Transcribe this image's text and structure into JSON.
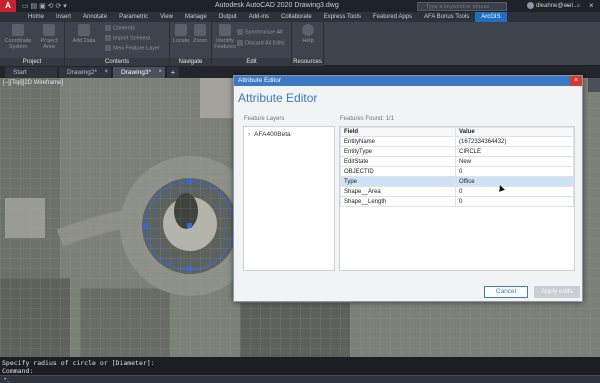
{
  "app": {
    "logo": "A",
    "title": "Autodesk AutoCAD 2020    Drawing3.dwg",
    "search_placeholder": "Type a keyword or phrase",
    "user": "dleahne@esri...",
    "window_controls": [
      "–",
      "▫",
      "×"
    ]
  },
  "ribbon_tabs": [
    "Home",
    "Insert",
    "Annotate",
    "Parametric",
    "View",
    "Manage",
    "Output",
    "Add-ins",
    "Collaborate",
    "Express Tools",
    "Featured Apps",
    "AFA Bonus Tools",
    "ArcGIS"
  ],
  "ribbon_active_tab": "ArcGIS",
  "ribbon_panels": {
    "project": {
      "label": "Project",
      "buttons": [
        "Coordinate System",
        "Project Area"
      ]
    },
    "contents": {
      "label": "Contents",
      "big": "Add Data",
      "small": [
        "Contents",
        "Import Schema",
        "New Feature Layer"
      ]
    },
    "navigate": {
      "label": "Navigate",
      "buttons": [
        "Locate",
        "Zoom"
      ]
    },
    "edit": {
      "label": "Edit",
      "big": "Identify Features",
      "small": [
        "Synchronize All",
        "Discard All Edits"
      ]
    },
    "resources": {
      "label": "Resources",
      "big": "Help"
    }
  },
  "doc_tabs": [
    {
      "label": "Start",
      "closable": false
    },
    {
      "label": "Drawing2*",
      "closable": true
    },
    {
      "label": "Drawing3*",
      "closable": true
    }
  ],
  "viewport": {
    "label": "[–][Top][2D Wireframe]"
  },
  "command_line": {
    "history": "Specify radius of circle or [Diameter]:",
    "prompt": "Command:"
  },
  "dialog": {
    "title": "Attribute Editor",
    "heading": "Attribute Editor",
    "feature_layers_label": "Feature Layers",
    "features_found_label": "Features Found: 1/1",
    "layer": "AFA400Beta",
    "columns": [
      "Field",
      "Value"
    ],
    "rows": [
      {
        "field": "EntityName",
        "value": "(1672334364432)"
      },
      {
        "field": "EntityType",
        "value": "CIRCLE"
      },
      {
        "field": "EditState",
        "value": "New"
      },
      {
        "field": "OBJECTID",
        "value": "0"
      },
      {
        "field": "Type",
        "value": "Office"
      },
      {
        "field": "Shape__Area",
        "value": "0"
      },
      {
        "field": "Shape__Length",
        "value": "0"
      }
    ],
    "selected_row": 4,
    "cancel_label": "Cancel",
    "apply_label": "Apply edits"
  },
  "colors": {
    "accent": "#3b79c2",
    "ribbon_active": "#1f6ec2",
    "close_button": "#d23a2e",
    "selection_circle": "#3366dd"
  }
}
